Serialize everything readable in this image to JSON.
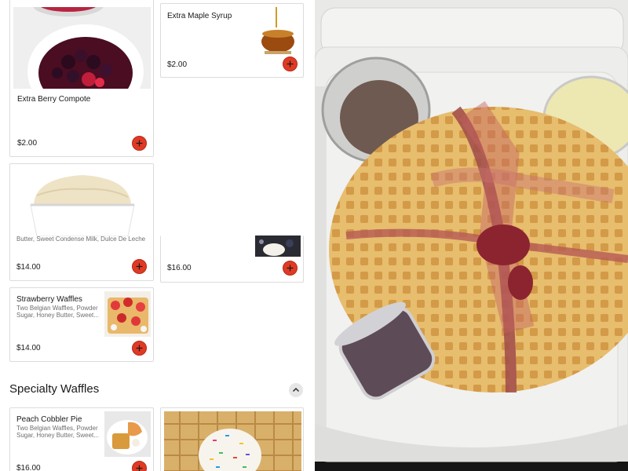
{
  "menu": {
    "items": [
      {
        "title": "Extra Berry Compote",
        "price": "$2.00",
        "image": "berry-compote-image"
      },
      {
        "title": "Extra Maple Syrup",
        "price": "$2.00",
        "image": "maple-syrup-image"
      },
      {
        "description": "Butter, Sweet Condense Milk, Dulce De Leche",
        "price": "$14.00",
        "image": "ice-cream-image"
      },
      {
        "price": "$16.00",
        "image": "waffle-ice-cream-image"
      },
      {
        "title": "Strawberry Waffles",
        "description_line1": "Two Belgian Waffles, Powder",
        "description_line2": "Sugar, Honey Butter, Sweet...",
        "price": "$14.00",
        "image": "strawberry-waffles-image"
      }
    ],
    "specialty_section": {
      "title": "Specialty Waffles",
      "items": [
        {
          "title": "Peach Cobbler Pie",
          "description_line1": "Two Belgian Waffles, Powder",
          "description_line2": "Sugar, Honey Butter, Sweet...",
          "price": "$16.00",
          "image": "peach-cobbler-image"
        },
        {
          "image": "sprinkles-waffle-image"
        }
      ]
    },
    "add_button_icon": "plus-icon",
    "collapse_icon": "chevron-up-icon"
  },
  "photo": {
    "subject": "waffle-takeout-photo"
  },
  "colors": {
    "accent": "#e03a24",
    "border": "#dcdcdc",
    "text": "#1a1a1a",
    "muted": "#6f6f6f"
  }
}
